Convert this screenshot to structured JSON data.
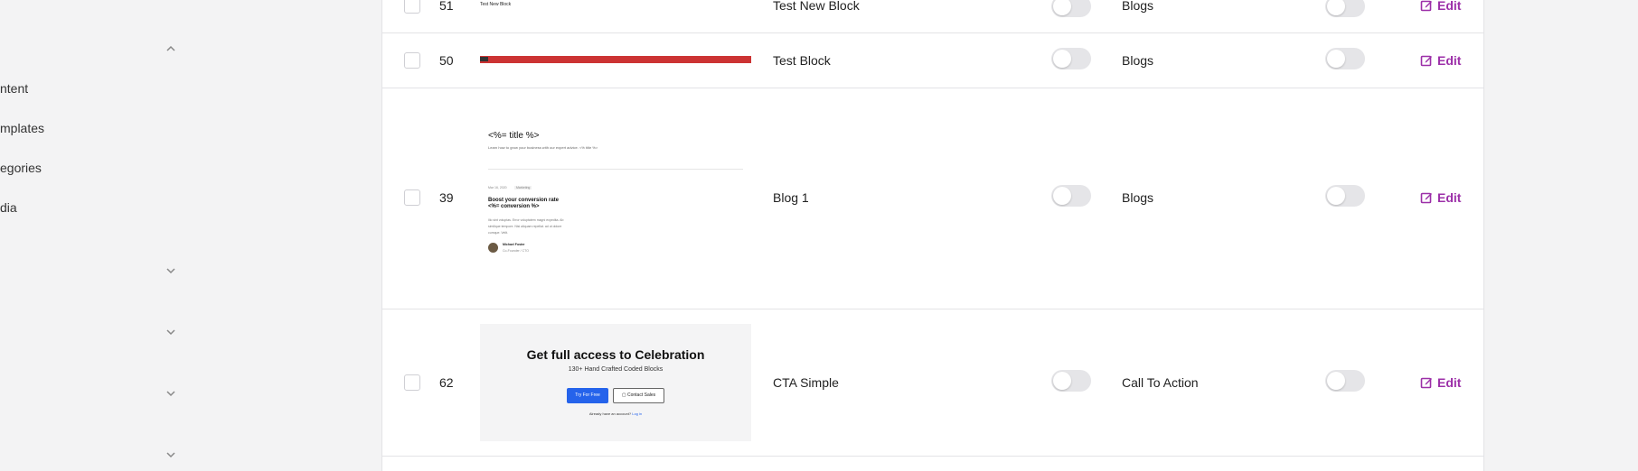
{
  "sidebar": {
    "items": [
      {
        "label": "ntent"
      },
      {
        "label": "mplates"
      },
      {
        "label": "egories"
      },
      {
        "label": "dia"
      }
    ]
  },
  "rows": [
    {
      "id": "51",
      "name": "Test New Block",
      "category": "Blogs",
      "action": "Edit",
      "preview_text": "Test New Block"
    },
    {
      "id": "50",
      "name": "Test Block",
      "category": "Blogs",
      "action": "Edit"
    },
    {
      "id": "39",
      "name": "Blog 1",
      "category": "Blogs",
      "action": "Edit",
      "preview": {
        "title": "<%= title %>",
        "subtitle": "Learn how to grow your business with our expert advice. <% title %>",
        "meta_date": "Mar 16, 2020",
        "meta_tag": "Marketing",
        "post_title": "Boost your conversion rate <%= conversion %>",
        "excerpt": "Illo sint voluptas. Error voluptatem magni expedita. Ab similique tempore. Nisi aliquam repellat. ad ut dolore cumque. Velit.",
        "author": "Michael Foster",
        "author_role": "Co-Founder / CTO"
      }
    },
    {
      "id": "62",
      "name": "CTA Simple",
      "category": "Call To Action",
      "action": "Edit",
      "preview": {
        "heading": "Get full access to Celebration",
        "sub": "130+ Hand Crafted Coded Blocks",
        "btn_primary": "Try For Free",
        "btn_secondary": "Contact Sales",
        "footer_text": "Already have an account?",
        "footer_link": "Log in"
      }
    }
  ],
  "colors": {
    "accent": "#9c2fa8",
    "bar_red": "#cc3333",
    "primary_btn": "#2563eb"
  }
}
